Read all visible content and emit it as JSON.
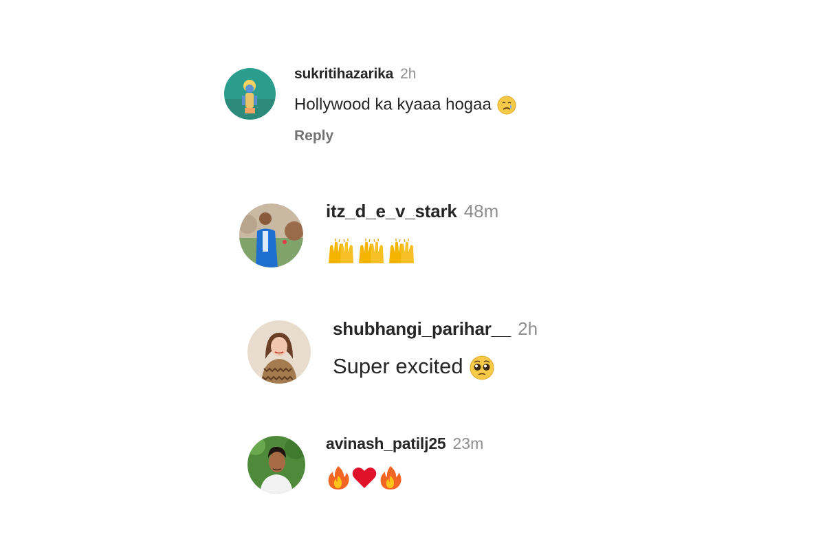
{
  "comments": [
    {
      "username": "sukritihazarika",
      "time": "2h",
      "text": "Hollywood ka kyaaa hogaa",
      "emoji": "crying-face-icon",
      "reply_label": "Reply"
    },
    {
      "username": "itz_d_e_v_stark",
      "time": "48m",
      "text": "",
      "emoji": "raising-hands-icon x3"
    },
    {
      "username": "shubhangi_parihar__",
      "time": "2h",
      "text": "Super excited",
      "emoji": "pleading-face-icon"
    },
    {
      "username": "avinash_patilj25",
      "time": "23m",
      "text": "",
      "emoji": "fire-icon, red-heart-icon, fire-icon"
    }
  ],
  "colors": {
    "username": "#262626",
    "timestamp": "#8e8e8e",
    "reply": "#737373",
    "background": "#ffffff"
  }
}
